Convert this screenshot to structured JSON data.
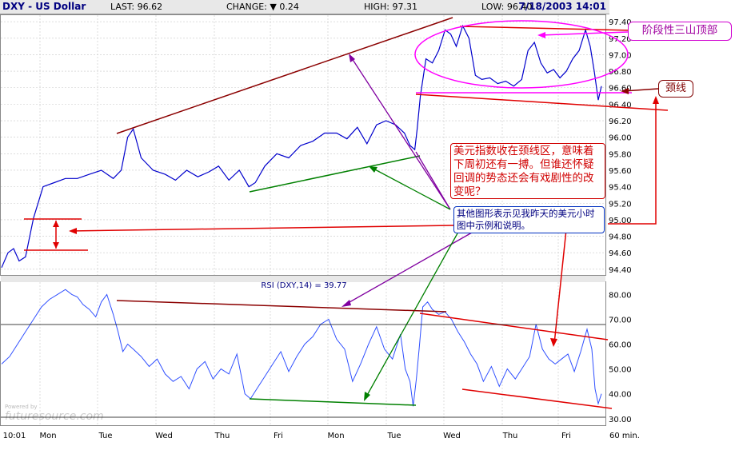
{
  "header": {
    "symbol": "DXY - US Dollar",
    "last": "LAST: 96.62",
    "change": "CHANGE: ▼ 0.24",
    "high": "HIGH: 97.31",
    "low": "LOW: 96.40",
    "datetime": "7/18/2003 14:01"
  },
  "annotations": {
    "top_label": "阶段性三山顶部",
    "neckline": "颈线",
    "note_red": "美元指数收在颈线区，意味着下周初还有一搏。但谁还怀疑回调的势态还会有戏剧性的改变呢？",
    "note_blue": "其他图形表示见我昨天的美元小时图中示例和说明。",
    "watermark": "futuresource.com",
    "powered": "Powered by"
  },
  "colors": {
    "price": "#0000cc",
    "rsi": "#3050ff",
    "red": "#e00000",
    "darkred": "#8b0000",
    "purple": "#8000a0",
    "green": "#008000",
    "magenta": "#ff00ff"
  },
  "chart_data": [
    {
      "type": "line",
      "symbol": "DXY - US Dollar",
      "x_ticks": [
        "10:01",
        "Mon",
        "Tue",
        "Wed",
        "Thu",
        "Fri",
        "Mon",
        "Tue",
        "Wed",
        "Thu",
        "Fri"
      ],
      "x_units": "60 min.",
      "y_ticks": [
        94.4,
        94.6,
        94.8,
        95.0,
        95.2,
        95.4,
        95.6,
        95.8,
        96.0,
        96.2,
        96.4,
        96.6,
        96.8,
        97.0,
        97.2,
        97.4
      ],
      "ylim": [
        94.35,
        97.45
      ],
      "grid": true,
      "x": [
        0,
        8,
        15,
        22,
        30,
        40,
        52,
        66,
        80,
        95,
        110,
        125,
        140,
        150,
        158,
        165,
        175,
        190,
        205,
        218,
        232,
        246,
        260,
        272,
        285,
        298,
        310,
        318,
        330,
        345,
        360,
        375,
        390,
        405,
        420,
        433,
        446,
        458,
        470,
        482,
        494,
        505,
        512,
        518,
        521,
        525,
        532,
        540,
        548,
        556,
        563,
        570,
        578,
        586,
        594,
        602,
        612,
        622,
        632,
        642,
        652,
        660,
        668,
        676,
        684,
        692,
        700,
        708,
        716,
        724,
        732,
        738,
        743,
        748,
        752
      ],
      "values": [
        94.42,
        94.6,
        94.65,
        94.5,
        94.55,
        95.02,
        95.4,
        95.45,
        95.5,
        95.5,
        95.55,
        95.6,
        95.5,
        95.6,
        96.0,
        96.1,
        95.75,
        95.6,
        95.55,
        95.48,
        95.6,
        95.52,
        95.58,
        95.65,
        95.48,
        95.6,
        95.4,
        95.45,
        95.65,
        95.8,
        95.75,
        95.9,
        95.95,
        96.05,
        96.05,
        95.98,
        96.12,
        95.92,
        96.15,
        96.2,
        96.15,
        96.05,
        95.9,
        95.85,
        96.1,
        96.5,
        96.95,
        96.9,
        97.05,
        97.3,
        97.25,
        97.1,
        97.35,
        97.2,
        96.75,
        96.7,
        96.72,
        96.65,
        96.68,
        96.62,
        96.7,
        97.05,
        97.15,
        96.9,
        96.78,
        96.82,
        96.72,
        96.8,
        96.95,
        97.05,
        97.3,
        97.1,
        96.8,
        96.45,
        96.62
      ]
    },
    {
      "type": "line",
      "title": "RSI (DXY,14) = 39.77",
      "y_ticks": [
        30,
        40,
        50,
        60,
        70,
        80
      ],
      "ylim": [
        28,
        84
      ],
      "grid": false,
      "x": [
        0,
        10,
        20,
        30,
        40,
        50,
        60,
        70,
        80,
        88,
        95,
        102,
        110,
        118,
        125,
        132,
        140,
        146,
        152,
        158,
        165,
        175,
        185,
        195,
        205,
        215,
        225,
        235,
        245,
        255,
        265,
        275,
        285,
        295,
        305,
        312,
        320,
        330,
        340,
        350,
        360,
        370,
        380,
        390,
        400,
        410,
        420,
        430,
        440,
        450,
        460,
        470,
        480,
        490,
        500,
        506,
        512,
        516,
        520,
        524,
        528,
        534,
        540,
        548,
        556,
        564,
        572,
        580,
        588,
        596,
        604,
        614,
        624,
        634,
        644,
        654,
        662,
        670,
        678,
        686,
        694,
        702,
        710,
        718,
        726,
        734,
        740,
        744,
        748,
        752
      ],
      "values": [
        52,
        55,
        60,
        65,
        70,
        75,
        78,
        80,
        82,
        80,
        79,
        76,
        74,
        71,
        77,
        80,
        72,
        65,
        57,
        60,
        58,
        55,
        51,
        54,
        48,
        45,
        47,
        42,
        50,
        53,
        46,
        50,
        48,
        56,
        40,
        38,
        42,
        47,
        52,
        57,
        49,
        55,
        60,
        63,
        68,
        70,
        62,
        58,
        45,
        52,
        60,
        67,
        58,
        54,
        64,
        50,
        45,
        35,
        46,
        60,
        75,
        77,
        74,
        72,
        73,
        70,
        65,
        61,
        56,
        52,
        45,
        51,
        43,
        50,
        46,
        51,
        55,
        68,
        58,
        54,
        52,
        54,
        56,
        49,
        57,
        66,
        58,
        42,
        36,
        40
      ]
    }
  ]
}
